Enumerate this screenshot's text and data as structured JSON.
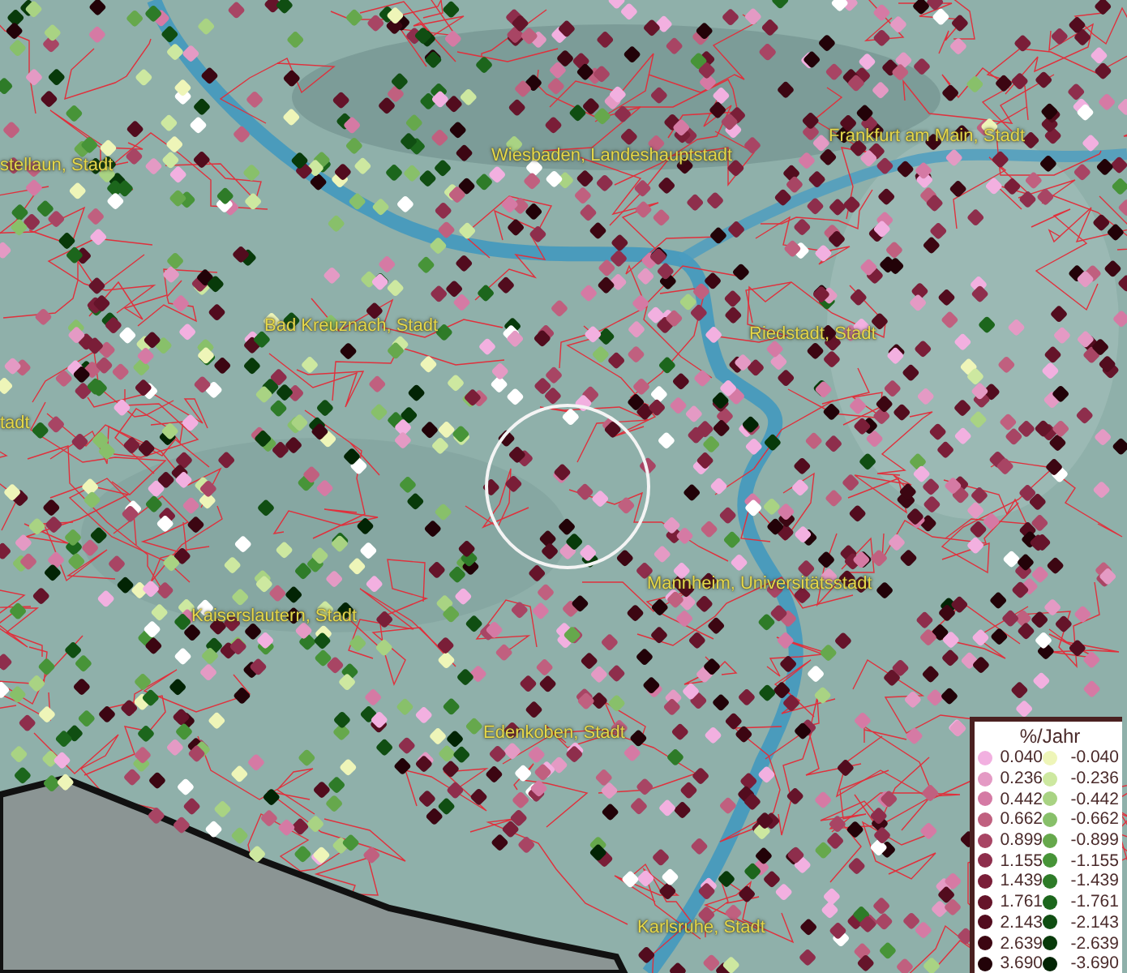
{
  "map": {
    "place_labels": [
      {
        "text": "stellaun, Stadt"
      },
      {
        "text": "Wiesbaden, Landeshauptstadt"
      },
      {
        "text": "Frankfurt am Main, Stadt"
      },
      {
        "text": "Bad Kreuznach, Stadt"
      },
      {
        "text": "Riedstadt, Stadt"
      },
      {
        "text": "tadt"
      },
      {
        "text": "Mannheim, Universitätsstadt"
      },
      {
        "text": "Kaiserslautern, Stadt"
      },
      {
        "text": "Edenkoben, Stadt"
      },
      {
        "text": "Karlsruhe, Stadt"
      }
    ]
  },
  "legend": {
    "title": "%/Jahr",
    "rows": [
      [
        {
          "label": "0.040",
          "color": "#f2b0e0"
        },
        {
          "label": "-0.040",
          "color": "#eef5b8"
        }
      ],
      [
        {
          "label": "0.236",
          "color": "#e49ac4"
        },
        {
          "label": "-0.236",
          "color": "#cde8a0"
        }
      ],
      [
        {
          "label": "0.442",
          "color": "#d57aa4"
        },
        {
          "label": "-0.442",
          "color": "#a9d383"
        }
      ],
      [
        {
          "label": "0.662",
          "color": "#c0607f"
        },
        {
          "label": "-0.662",
          "color": "#88c06a"
        }
      ],
      [
        {
          "label": "0.899",
          "color": "#a84564"
        },
        {
          "label": "-0.899",
          "color": "#66a84c"
        }
      ],
      [
        {
          "label": "1.155",
          "color": "#8e2e4c"
        },
        {
          "label": "-1.155",
          "color": "#479438"
        }
      ],
      [
        {
          "label": "1.439",
          "color": "#7a1e38"
        },
        {
          "label": "-1.439",
          "color": "#2e7b28"
        }
      ],
      [
        {
          "label": "1.761",
          "color": "#65142a"
        },
        {
          "label": "-1.761",
          "color": "#1c661c"
        }
      ],
      [
        {
          "label": "2.143",
          "color": "#520c1e"
        },
        {
          "label": "-2.143",
          "color": "#104e12"
        }
      ],
      [
        {
          "label": "2.639",
          "color": "#3c0612"
        },
        {
          "label": "-2.639",
          "color": "#083a0a"
        }
      ],
      [
        {
          "label": "3.690",
          "color": "#220208"
        },
        {
          "label": "-3.690",
          "color": "#022404"
        }
      ]
    ]
  }
}
